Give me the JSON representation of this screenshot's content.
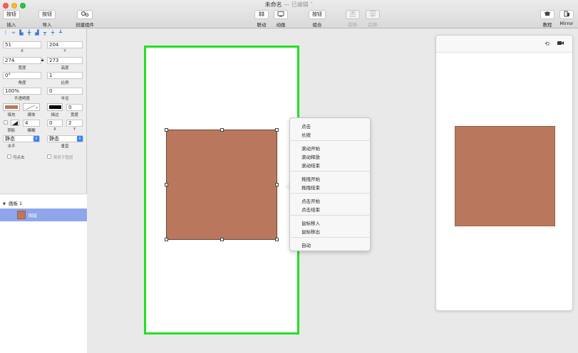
{
  "window": {
    "title": "未命名",
    "status": " — 已编辑 ˅"
  },
  "toolbar": {
    "insert": {
      "button": "按钮",
      "label": "插入"
    },
    "import": {
      "button": "按钮",
      "label": "导入"
    },
    "create_component": {
      "label": "创建组件"
    },
    "link": {
      "label": "联动"
    },
    "animate": {
      "label": "动画"
    },
    "group": {
      "button": "按钮",
      "label": "组合"
    },
    "bring_forward": {
      "label": "前移"
    },
    "send_backward": {
      "label": "后移"
    },
    "tutorial": {
      "label": "教程"
    },
    "mirror": {
      "label": "Mirror"
    }
  },
  "inspector": {
    "x": {
      "value": "51",
      "label": "X"
    },
    "y": {
      "value": "204",
      "label": "Y"
    },
    "width": {
      "value": "274",
      "label": "宽度"
    },
    "height": {
      "value": "273",
      "label": "高度"
    },
    "angle": {
      "value": "0°",
      "label": "角度"
    },
    "scale": {
      "value": "1",
      "label": "比例"
    },
    "opacity": {
      "value": "100%",
      "label": "不透明度"
    },
    "radius": {
      "value": "0",
      "label": "半径"
    },
    "fill": {
      "label": "填充",
      "color": "#b9785d"
    },
    "media": {
      "label": "媒体"
    },
    "stroke": {
      "label": "描边",
      "color": "#000000"
    },
    "stroke_width": {
      "value": "0",
      "label": "宽度"
    },
    "shadow": {
      "label": "阴影"
    },
    "blur": {
      "value": "4",
      "label": "模糊"
    },
    "shadow_x": {
      "value": "0",
      "label": "X"
    },
    "shadow_y": {
      "value": "2",
      "label": "Y"
    },
    "horizontal": {
      "value": "静态",
      "label": "水平"
    },
    "vertical": {
      "value": "静态",
      "label": "垂直"
    },
    "clickable": {
      "label": "可点击"
    },
    "clip_layer": {
      "label": "裁剪子图层"
    }
  },
  "layers": {
    "board": "画板 1",
    "layer": "图层"
  },
  "menu": {
    "items": [
      "点击",
      "长按",
      "滚动开始",
      "滚动释放",
      "滚动结束",
      "拖拽开始",
      "拖拽结束",
      "点击开始",
      "点击结束",
      "鼠标移入",
      "鼠标移出",
      "自动"
    ]
  },
  "colors": {
    "artboard_border": "#24e024",
    "shape_fill": "#b9785d",
    "selection": "#8fa6ec"
  }
}
